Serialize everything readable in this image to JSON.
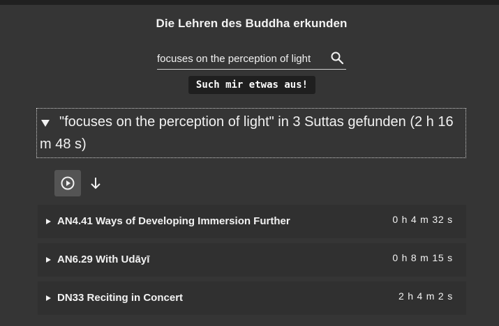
{
  "header": {
    "title": "Die Lehren des Buddha erkunden"
  },
  "search": {
    "value": "focuses on the perception of light",
    "button_label": "Such mir etwas aus!"
  },
  "results": {
    "summary_line1": "\"focuses on the perception of light\" in 3 Suttas gefunden (2 h 16",
    "summary_line2": "m 48 s)",
    "items": [
      {
        "title": "AN4.41 Ways of Developing Immersion Further",
        "duration": "0 h 4 m 32 s"
      },
      {
        "title": "AN6.29 With Udāyī",
        "duration": "0 h 8 m 15 s"
      },
      {
        "title": "DN33 Reciting in Concert",
        "duration": "2 h 4 m 2 s"
      }
    ]
  },
  "icons": {
    "search": "search-icon",
    "play": "play-circle-icon",
    "download": "arrow-down-icon",
    "expand": "triangle-down-icon",
    "row_expand": "triangle-right-icon"
  },
  "colors": {
    "background": "#353535",
    "row": "#303030",
    "button": "#1f1f1f",
    "play_button": "#545454",
    "text": "#f2f2f2"
  }
}
